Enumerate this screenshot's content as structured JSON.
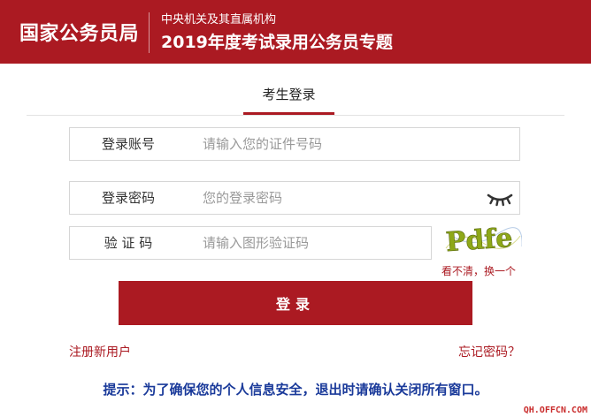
{
  "header": {
    "brand": "国家公务员局",
    "subtitle_1": "中央机关及其直属机构",
    "subtitle_2": "2019年度考试录用公务员专题"
  },
  "tabs": [
    {
      "label": "考生登录",
      "active": true
    }
  ],
  "form": {
    "account": {
      "label": "登录账号",
      "placeholder": "请输入您的证件号码",
      "value": ""
    },
    "password": {
      "label": "登录密码",
      "placeholder": "您的登录密码",
      "value": "",
      "toggle_icon": "eye-closed-icon"
    },
    "captcha": {
      "label": "验 证 码",
      "placeholder": "请输入图形验证码",
      "value": "",
      "image_text": "Pdfe",
      "refresh_label": "看不清，换一个"
    },
    "submit_label": "登录"
  },
  "links": {
    "register": "注册新用户",
    "forgot": "忘记密码？"
  },
  "tip": "提示：为了确保您的个人信息安全，退出时请确认关闭所有窗口。",
  "watermark": "QH.OFFCN.COM",
  "colors": {
    "brand_red": "#ab1a22",
    "tip_blue": "#1a3a9a",
    "border_gray": "#d6d6d6"
  }
}
